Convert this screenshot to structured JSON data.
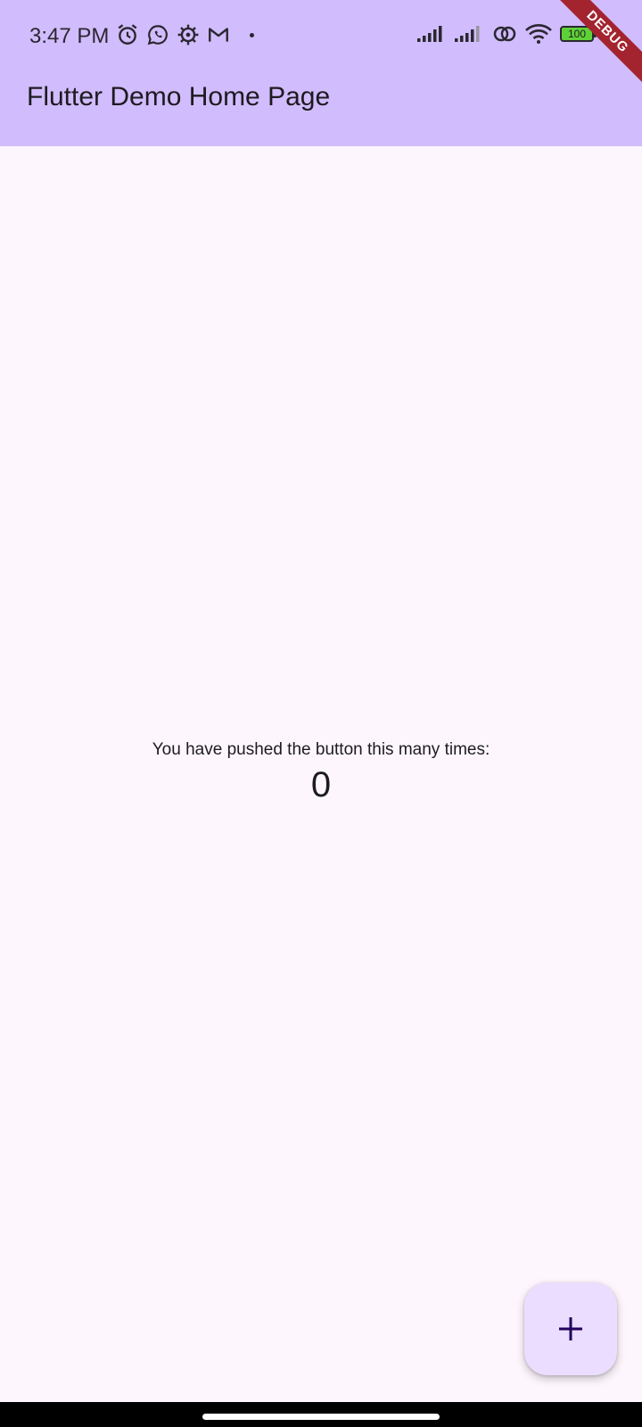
{
  "status_bar": {
    "time": "3:47 PM",
    "battery_level": "100",
    "icons_left": [
      "alarm-icon",
      "whatsapp-icon",
      "settings-icon",
      "gmail-icon",
      "notification-dot"
    ],
    "icons_right": [
      "signal-icon",
      "signal-icon",
      "hotspot-icon",
      "wifi-icon",
      "battery-icon"
    ]
  },
  "app_bar": {
    "title": "Flutter Demo Home Page",
    "background": "#d1bcfd"
  },
  "debug_banner": {
    "label": "DEBUG",
    "color": "#a3242e"
  },
  "main": {
    "counter_label": "You have pushed the button this many times:",
    "counter_value": "0",
    "background": "#fdf7fd"
  },
  "fab": {
    "icon": "add-icon",
    "background": "#eaddff",
    "icon_color": "#21005d"
  }
}
